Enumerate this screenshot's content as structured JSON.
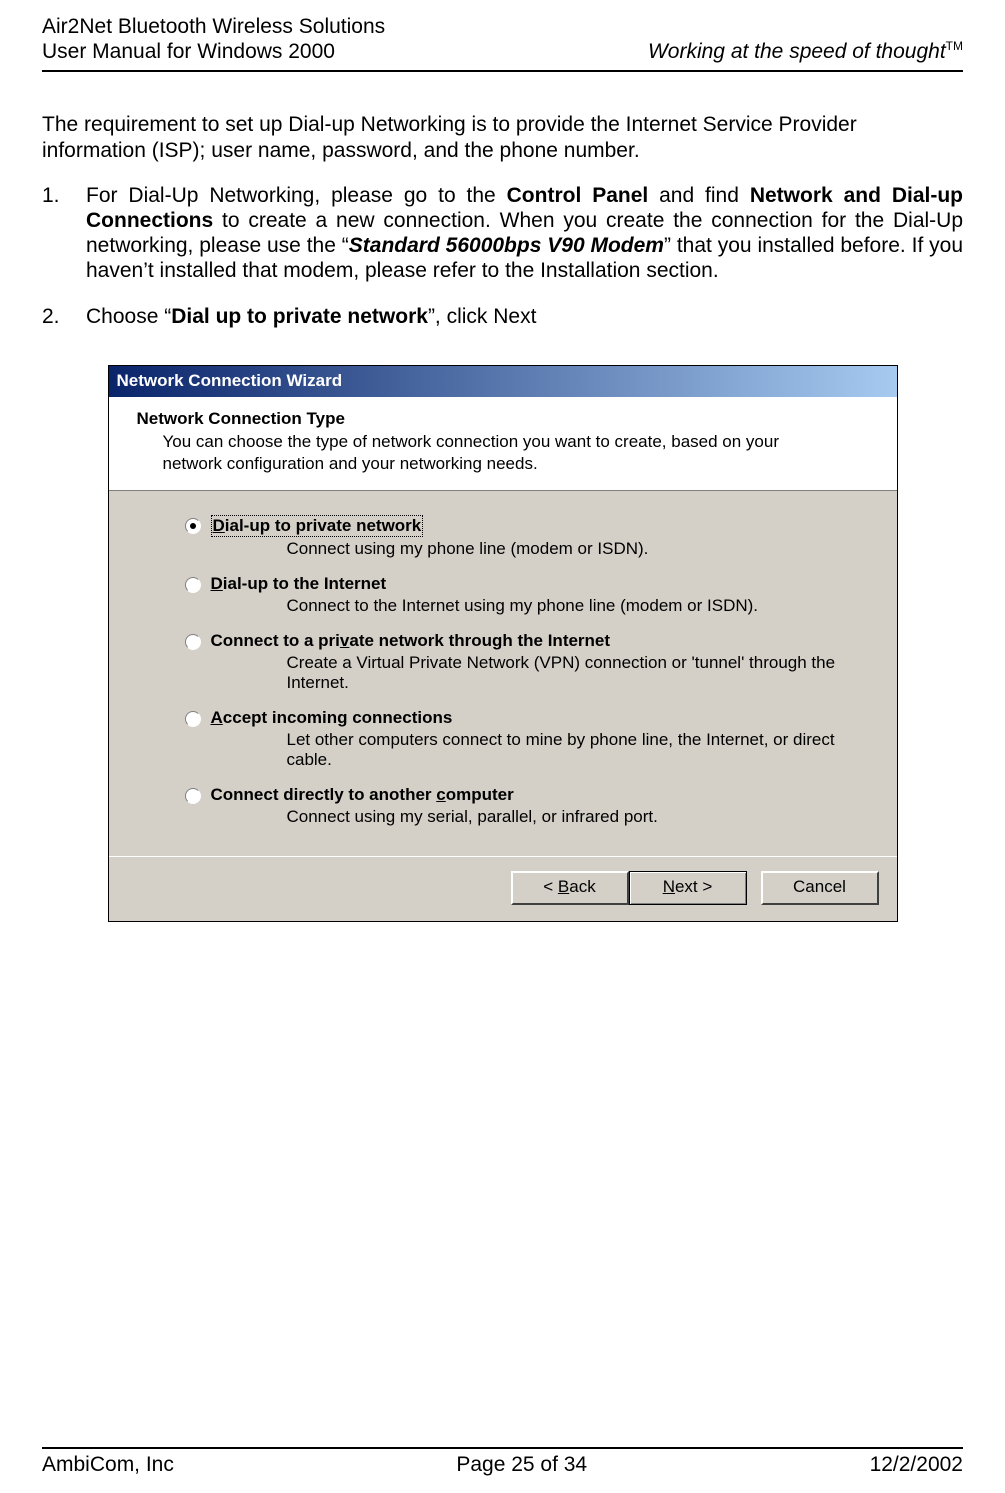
{
  "header": {
    "left_line1": "Air2Net Bluetooth Wireless Solutions",
    "left_line2": "User Manual for Windows 2000",
    "right": "Working at the speed of thought",
    "tm": "TM"
  },
  "intro": "The requirement to set up Dial-up Networking is to provide the Internet Service Provider information (ISP); user name, password, and the phone number.",
  "step1": {
    "num": "1.",
    "t1": "For Dial-Up Networking, please go to the ",
    "b1": "Control Panel",
    "t2": " and find ",
    "b2": "Network and Dial-up Connections",
    "t3": " to create a new connection.  When you create the connection for the Dial-Up networking, please use the “",
    "b3": "Standard 56000bps V90 Modem",
    "t4": "” that you installed before. If you haven’t installed that modem, please refer to the Installation section."
  },
  "step2": {
    "num": "2.",
    "t1": "Choose “",
    "b1": "Dial up to private network",
    "t2": "”, click Next"
  },
  "wizard": {
    "title": "Network Connection Wizard",
    "heading": "Network Connection Type",
    "sub": "You can choose the type of network connection you want to create, based on your network configuration and your networking needs.",
    "options": [
      {
        "selected": true,
        "pre": "",
        "u": "D",
        "post": "ial-up to private network",
        "desc": "Connect using my phone line (modem or ISDN)."
      },
      {
        "selected": false,
        "pre": "",
        "u": "D",
        "post": "ial-up to the Internet",
        "desc": "Connect to the Internet using my phone line (modem or ISDN)."
      },
      {
        "selected": false,
        "pre": "Connect to a pri",
        "u": "v",
        "post": "ate network through the Internet",
        "desc": "Create a Virtual Private Network (VPN) connection or 'tunnel' through the Internet."
      },
      {
        "selected": false,
        "pre": "",
        "u": "A",
        "post": "ccept incoming connections",
        "desc": "Let other computers connect to mine by phone line, the Internet, or direct cable."
      },
      {
        "selected": false,
        "pre": "Connect directly to another ",
        "u": "c",
        "post": "omputer",
        "desc": "Connect using my serial, parallel, or infrared port."
      }
    ],
    "back_pre": "< ",
    "back_u": "B",
    "back_post": "ack",
    "next_u": "N",
    "next_post": "ext >",
    "cancel": "Cancel"
  },
  "footer": {
    "left": "AmbiCom, Inc",
    "center": "Page 25 of 34",
    "right": "12/2/2002"
  }
}
